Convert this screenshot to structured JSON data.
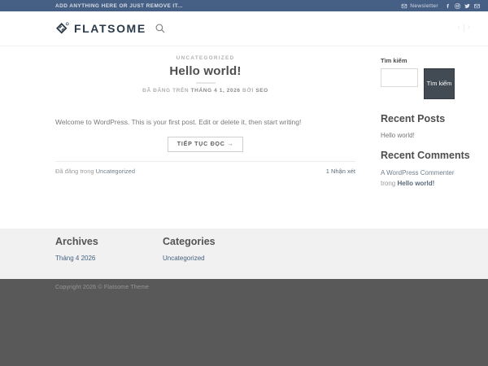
{
  "topbar": {
    "left_text": "ADD ANYTHING HERE OR JUST REMOVE IT...",
    "newsletter_label": "Newsletter",
    "social_icons": [
      "envelope-icon",
      "facebook-icon",
      "instagram-icon",
      "twitter-icon",
      "email-icon"
    ]
  },
  "header": {
    "logo_text": "FLATSOME",
    "logo_icon": "flatsome-diamond-logo",
    "search_icon": "search-icon",
    "nav_prev": "‹",
    "nav_next": "›"
  },
  "post": {
    "category": "UNCATEGORIZED",
    "title": "Hello world!",
    "posted_on_prefix": "ĐÃ ĐĂNG TRÊN",
    "date": "THÁNG 4 1, 2026",
    "by_label": "BỞI",
    "author": "SEO",
    "excerpt": "Welcome to WordPress. This is your first post. Edit or delete it, then start writing!",
    "read_more_label": "TIẾP TỤC ĐỌC →",
    "posted_in_prefix": "Đã đăng trong",
    "posted_in_category": "Uncategorized",
    "comments_label": "1 Nhận xét"
  },
  "sidebar": {
    "search_title": "Tìm kiếm",
    "search_button_label": "Tìm kiếm",
    "search_input_value": "",
    "recent_posts_title": "Recent Posts",
    "recent_posts": [
      "Hello world!"
    ],
    "recent_comments_title": "Recent Comments",
    "recent_comments": [
      {
        "author": "A WordPress Commenter",
        "prefix": "trong",
        "post": "Hello world!"
      }
    ]
  },
  "footer": {
    "archives_title": "Archives",
    "archives": [
      "Tháng 4 2026"
    ],
    "categories_title": "Categories",
    "categories": [
      "Uncategorized"
    ],
    "copyright": "Copyright 2026 © Flatsome Theme"
  },
  "colors": {
    "topbar_bg": "#455f85",
    "logo_color": "#2b3a4a",
    "button_dark": "#424a53",
    "link_color": "#44607f",
    "footer_light_bg": "#f1f1f1",
    "footer_dark_bg": "#595959"
  }
}
